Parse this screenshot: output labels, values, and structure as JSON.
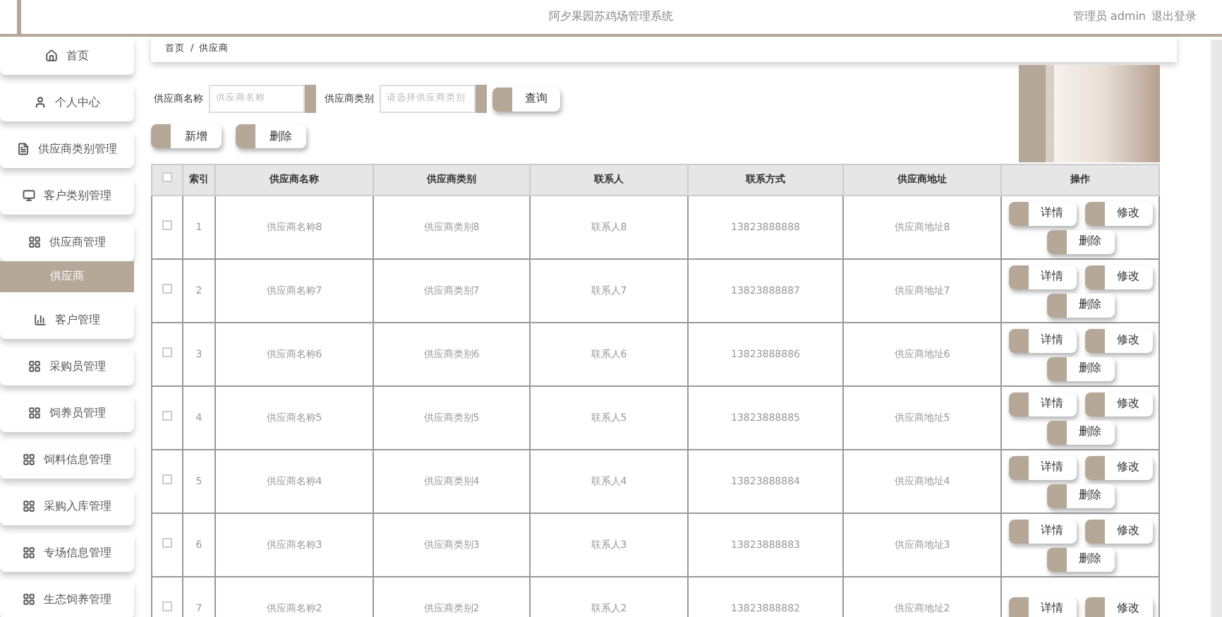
{
  "header": {
    "title": "阿夕果园苏鸡场管理系统",
    "user_role": "管理员",
    "username": "admin",
    "logout": "退出登录"
  },
  "sidebar": {
    "items": [
      {
        "label": "首页",
        "selected": false
      },
      {
        "label": "个人中心",
        "selected": false
      },
      {
        "label": "供应商类别管理",
        "selected": false
      },
      {
        "label": "客户类别管理",
        "selected": false
      },
      {
        "label": "供应商管理",
        "selected": false,
        "children": [
          {
            "label": "供应商",
            "selected": true
          }
        ]
      },
      {
        "label": "客户管理",
        "selected": false
      },
      {
        "label": "采购员管理",
        "selected": false
      },
      {
        "label": "饲养员管理",
        "selected": false
      },
      {
        "label": "饲料信息管理",
        "selected": false
      },
      {
        "label": "采购入库管理",
        "selected": false
      },
      {
        "label": "专场信息管理",
        "selected": false
      },
      {
        "label": "生态饲养管理",
        "selected": false
      }
    ]
  },
  "breadcrumb": {
    "items": [
      "首页",
      "供应商"
    ],
    "separator": "/"
  },
  "search": {
    "fields": [
      {
        "label": "供应商名称",
        "placeholder": "供应商名称"
      },
      {
        "label": "供应商类别",
        "placeholder": "请选择供应商类别"
      }
    ],
    "button": "查询"
  },
  "actions": [
    "新增",
    "删除"
  ],
  "table": {
    "select_all": {
      "checked": false
    },
    "columns": [
      "索引",
      "供应商名称",
      "供应商类别",
      "联系人",
      "联系方式",
      "供应商地址",
      "操作"
    ],
    "rows": [
      {
        "checked": false,
        "index": "1",
        "name": "供应商名称8",
        "category": "供应商类别8",
        "contact": "联系人8",
        "phone": "13823888888",
        "address": "供应商地址8",
        "buttons": [
          "详情",
          "修改",
          "删除"
        ]
      },
      {
        "checked": false,
        "index": "2",
        "name": "供应商名称7",
        "category": "供应商类别7",
        "contact": "联系人7",
        "phone": "13823888887",
        "address": "供应商地址7",
        "buttons": [
          "详情",
          "修改",
          "删除"
        ]
      },
      {
        "checked": false,
        "index": "3",
        "name": "供应商名称6",
        "category": "供应商类别6",
        "contact": "联系人6",
        "phone": "13823888886",
        "address": "供应商地址6",
        "buttons": [
          "详情",
          "修改",
          "删除"
        ]
      },
      {
        "checked": false,
        "index": "4",
        "name": "供应商名称5",
        "category": "供应商类别5",
        "contact": "联系人5",
        "phone": "13823888885",
        "address": "供应商地址5",
        "buttons": [
          "详情",
          "修改",
          "删除"
        ]
      },
      {
        "checked": false,
        "index": "5",
        "name": "供应商名称4",
        "category": "供应商类别4",
        "contact": "联系人4",
        "phone": "13823888884",
        "address": "供应商地址4",
        "buttons": [
          "详情",
          "修改",
          "删除"
        ]
      },
      {
        "checked": false,
        "index": "6",
        "name": "供应商名称3",
        "category": "供应商类别3",
        "contact": "联系人3",
        "phone": "13823888883",
        "address": "供应商地址3",
        "buttons": [
          "详情",
          "修改",
          "删除"
        ]
      },
      {
        "checked": false,
        "index": "7",
        "name": "供应商名称2",
        "category": "供应商类别2",
        "contact": "联系人2",
        "phone": "13823888882",
        "address": "供应商地址2",
        "buttons": [
          "详情",
          "修改"
        ]
      }
    ]
  }
}
